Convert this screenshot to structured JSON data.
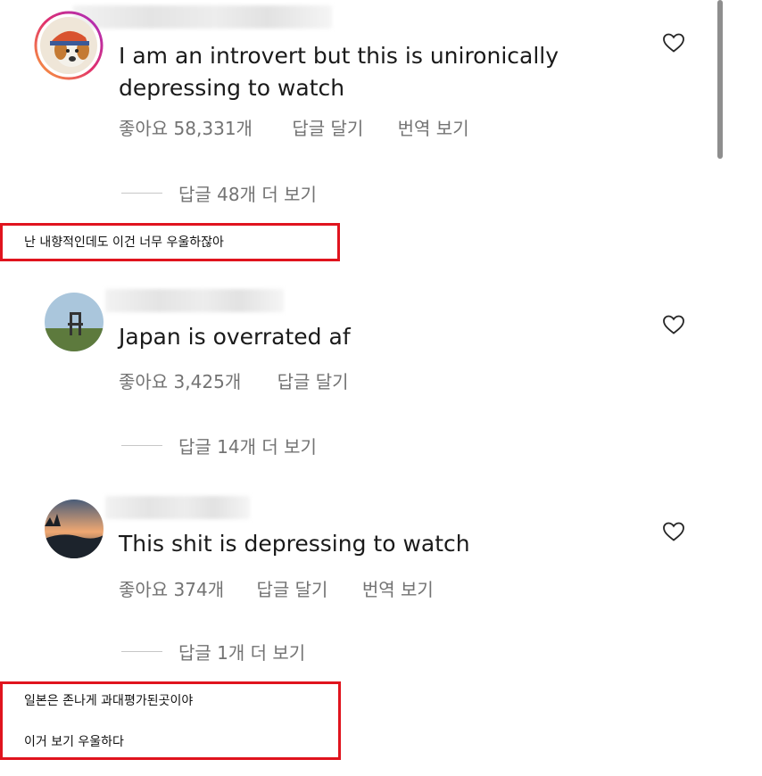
{
  "comments": [
    {
      "text": "I am an introvert but this is unironically depressing to watch",
      "likes": "좋아요 58,331개",
      "reply": "답글 달기",
      "translate": "번역 보기",
      "view_replies": "답글 48개 더 보기"
    },
    {
      "text": "Japan is overrated af",
      "likes": "좋아요 3,425개",
      "reply": "답글 달기",
      "view_replies": "답글 14개 더 보기"
    },
    {
      "text": "This shit is depressing to watch",
      "likes": "좋아요 374개",
      "reply": "답글 달기",
      "translate": "번역 보기",
      "view_replies": "답글 1개 더 보기"
    }
  ],
  "captions": {
    "first": "난 내향적인데도 이건 너무 우울하잖아",
    "second_line1": "일본은 존나게 과대평가된곳이야",
    "second_line2": "이거 보기 우울하다"
  },
  "icons": {
    "like": "heart-outline-icon"
  },
  "colors": {
    "highlight_border": "#e0141e",
    "meta_text": "#737373",
    "story_ring": "#d6249f"
  }
}
